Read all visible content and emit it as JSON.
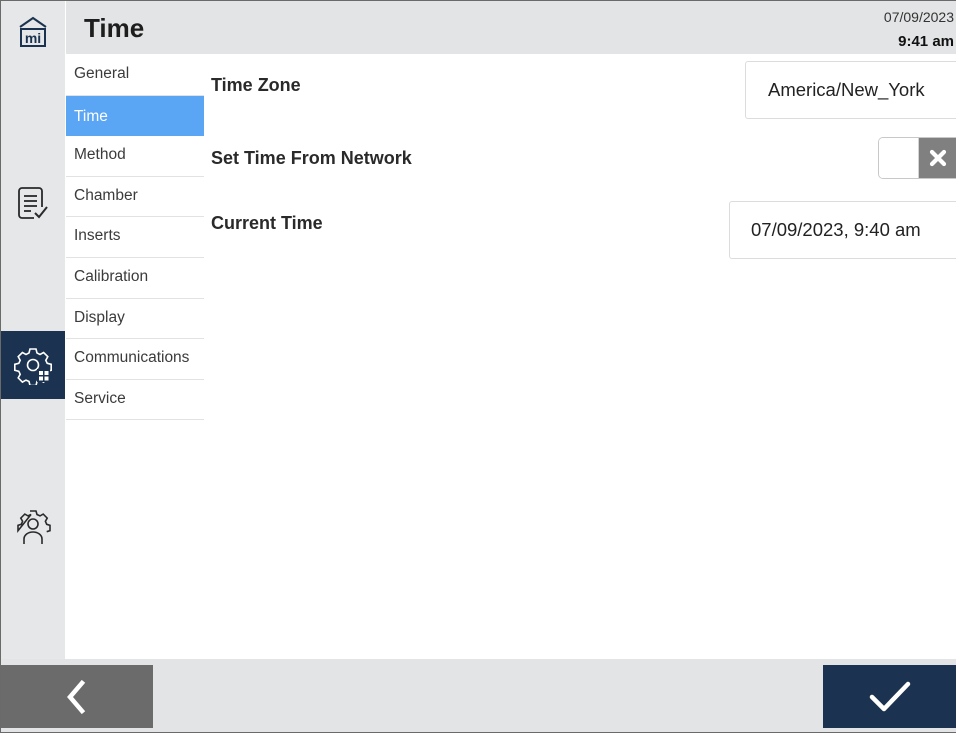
{
  "header": {
    "title": "Time",
    "date": "07/09/2023",
    "time": "9:41 am"
  },
  "rail": {
    "icons": [
      "home-mi-icon",
      "method-list-icon",
      "instrument-settings-icon",
      "user-settings-icon"
    ],
    "active_color": "#1b3350",
    "background": "#e6e7e8"
  },
  "submenu": {
    "items": [
      {
        "label": "General",
        "active": false
      },
      {
        "label": "Time",
        "active": true
      },
      {
        "label": "Method",
        "active": false
      },
      {
        "label": "Chamber",
        "active": false
      },
      {
        "label": "Inserts",
        "active": false
      },
      {
        "label": "Calibration",
        "active": false
      },
      {
        "label": "Display",
        "active": false
      },
      {
        "label": "Communications",
        "active": false
      },
      {
        "label": "Service",
        "active": false
      }
    ],
    "active_color": "#5aa6f4"
  },
  "settings": {
    "time_zone": {
      "label": "Time Zone",
      "value": "America/New_York"
    },
    "set_time_from_network": {
      "label": "Set Time From Network",
      "enabled": false
    },
    "current_time": {
      "label": "Current Time",
      "value": "07/09/2023, 9:40 am"
    }
  },
  "footer": {
    "back_icon": "chevron-left-icon",
    "confirm_icon": "checkmark-icon"
  }
}
